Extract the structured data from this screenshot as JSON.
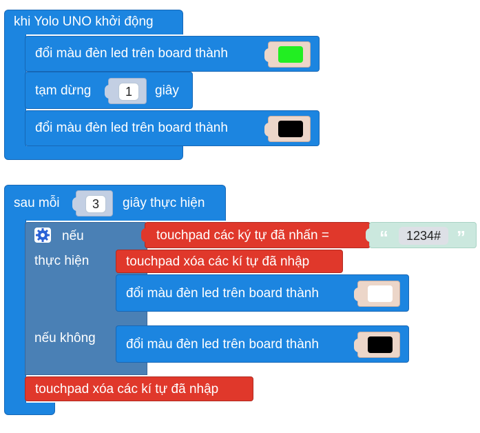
{
  "block1": {
    "hat_label": "khi Yolo UNO khởi động",
    "set_led_label_1": "đổi màu đèn led trên board thành",
    "led_color_1": "#22ee22",
    "pause_label": "tạm dừng",
    "pause_value": "1",
    "pause_unit": "giây",
    "set_led_label_2": "đổi màu đèn led trên board thành",
    "led_color_2": "#000000"
  },
  "block2": {
    "every_label": "sau mỗi",
    "every_value": "3",
    "every_suffix": "giây thực hiện",
    "if_label": "nếu",
    "do_label": "thực hiện",
    "else_label": "nếu không",
    "condition_label": "touchpad các ký tự đã nhấn =",
    "condition_text_value": "1234#",
    "open_quote": "“",
    "close_quote": "”",
    "clear_label_1": "touchpad xóa các kí tự đã nhập",
    "set_led_label_do": "đổi màu đèn led trên board thành",
    "led_color_do": "#ffffff",
    "set_led_label_else": "đổi màu đèn led trên board thành",
    "led_color_else": "#000000",
    "clear_label_2": "touchpad xóa các kí tự đã nhập"
  },
  "colors": {
    "block_blue": "#1c85e0",
    "control_blue": "#4a80b5",
    "touchpad_red": "#e0382b",
    "text_block": "#cbe8de",
    "color_value_frame": "#ecd6c9",
    "gear_icon": "#2b62d6"
  }
}
